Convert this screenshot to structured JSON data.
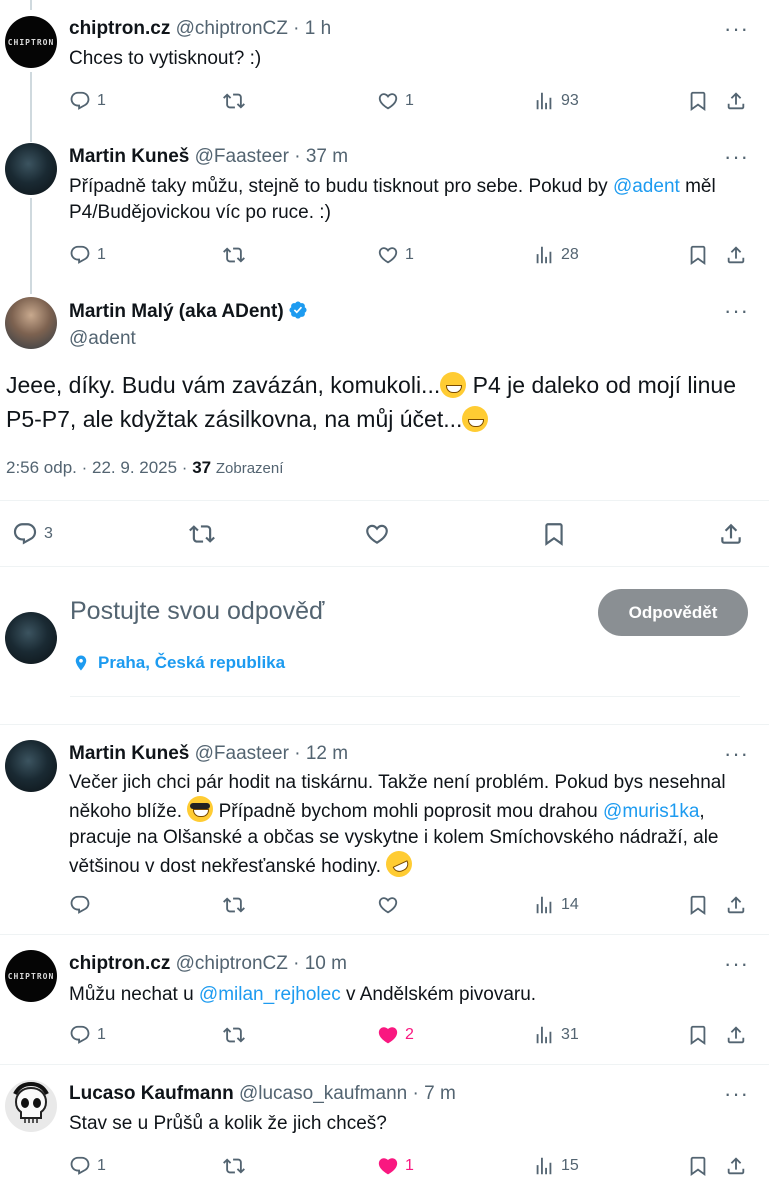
{
  "posts": [
    {
      "id": "p1",
      "name": "chiptron.cz",
      "handle": "@chiptronCZ",
      "time": "1 h",
      "avatar_text": "CHIPTRON",
      "text": "Chces to vytisknout? :)",
      "stats": {
        "replies": "1",
        "reposts": "",
        "likes": "1",
        "views": "93"
      }
    },
    {
      "id": "p2",
      "name": "Martin Kuneš",
      "handle": "@Faasteer",
      "time": "37 m",
      "text_parts": [
        "Případně taky můžu, stejně to budu tisknout pro sebe. Pokud by ",
        "@adent",
        " měl P4/Budějovickou víc po ruce. :)"
      ],
      "stats": {
        "replies": "1",
        "reposts": "",
        "likes": "1",
        "views": "28"
      }
    },
    {
      "id": "main",
      "name": "Martin Malý (aka ADent)",
      "handle": "@adent",
      "verified": true,
      "text_parts": [
        "Jeee, díky. Budu vám zavázán, komukoli...",
        " P4 je daleko od mojí linue P5-P7, ale kdyžtak zásilkovna, na můj účet..."
      ],
      "timestamp": "2:56 odp. · 22. 9. 2025 ·",
      "views_count": "37",
      "views_label": "Zobrazení",
      "stats": {
        "replies": "3"
      }
    }
  ],
  "composer": {
    "placeholder": "Postujte svou odpověď",
    "button": "Odpovědět",
    "location": "Praha, Česká republika"
  },
  "replies": [
    {
      "id": "r1",
      "name": "Martin Kuneš",
      "handle": "@Faasteer",
      "time": "12 m",
      "text_parts": [
        "Večer jich chci pár hodit na tiskárnu. Takže není problém. Pokud bys nesehnal někoho blíže. ",
        " Případně bychom mohli poprosit mou drahou ",
        "@muris1ka",
        ", pracuje na Olšanské a občas se vyskytne i kolem Smíchovského nádraží, ale většinou v dost nekřesťanské hodiny. "
      ],
      "stats": {
        "replies": "",
        "reposts": "",
        "likes": "",
        "views": "14"
      }
    },
    {
      "id": "r2",
      "name": "chiptron.cz",
      "handle": "@chiptronCZ",
      "time": "10 m",
      "avatar_text": "CHIPTRON",
      "text_parts": [
        "Můžu nechat u ",
        "@milan_rejholec",
        " v Andělském pivovaru."
      ],
      "stats": {
        "replies": "1",
        "reposts": "",
        "likes": "2",
        "views": "31"
      }
    },
    {
      "id": "r3",
      "name": "Lucaso Kaufmann",
      "handle": "@lucaso_kaufmann",
      "time": "7 m",
      "text": "Stav se u Průšů a kolik že jich chceš?",
      "stats": {
        "replies": "1",
        "reposts": "",
        "likes": "1",
        "views": "15"
      }
    }
  ],
  "ui": {
    "separator": "·",
    "more": "···",
    "accent_color": "#1d9bf0",
    "like_color": "#f91880",
    "icons": [
      "reply-icon",
      "repost-icon",
      "like-icon",
      "views-icon",
      "bookmark-icon",
      "share-icon",
      "location-pin-icon",
      "verified-badge-icon",
      "more-icon"
    ]
  }
}
